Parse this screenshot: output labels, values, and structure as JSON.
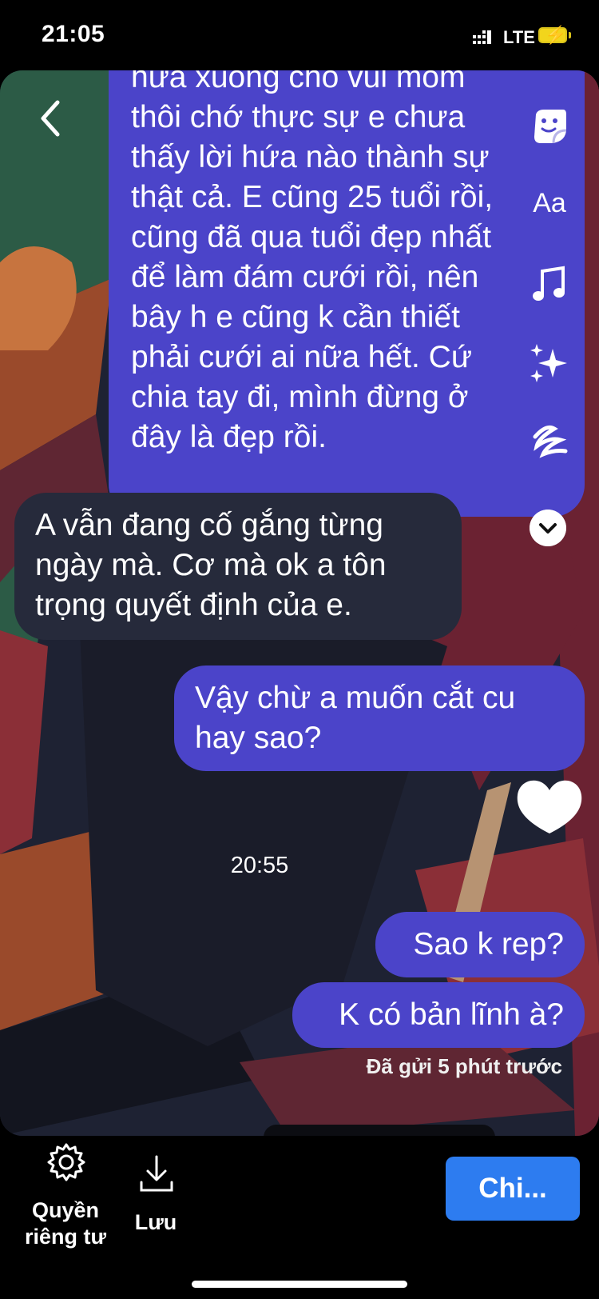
{
  "status_bar": {
    "time": "21:05",
    "network": "LTE"
  },
  "messages": [
    {
      "direction": "outgoing",
      "lines": [
        "hứa xuông cho vui mồm",
        "thôi chớ thực sự e chưa",
        "thấy lời hứa nào thành sự",
        "thật cả. E cũng 25 tuổi rồi,",
        "cũng đã qua tuổi đẹp nhất",
        "để làm đám cưới rồi, nên",
        "bây h e cũng k cần thiết",
        "phải cưới ai nữa hết. Cứ",
        "chia tay đi, mình đừng ở",
        "đây là đẹp rồi."
      ]
    },
    {
      "direction": "incoming",
      "lines": [
        "A vẫn đang cố gắng từng",
        "ngày mà. Cơ mà ok a tôn",
        "trọng quyết định của e."
      ]
    },
    {
      "direction": "outgoing",
      "lines": [
        "Vậy chừ a muốn cắt cu",
        "hay sao?"
      ]
    },
    {
      "direction": "outgoing",
      "lines": [
        "Sao k rep?"
      ]
    },
    {
      "direction": "outgoing",
      "lines": [
        "K có bản lĩnh à?"
      ]
    }
  ],
  "timestamp": "20:55",
  "seen_status": "Đã gửi 5 phút trước",
  "story_tools": {
    "text_tool": "Aa"
  },
  "bottom_bar": {
    "privacy_label_1": "Quyền",
    "privacy_label_2": "riêng tư",
    "save_label": "Lưu",
    "share_button": "Chi..."
  },
  "colors": {
    "outgoing_bubble": "#4b44c9",
    "incoming_bubble": "#262a3b",
    "share_button": "#2d7cf0"
  }
}
